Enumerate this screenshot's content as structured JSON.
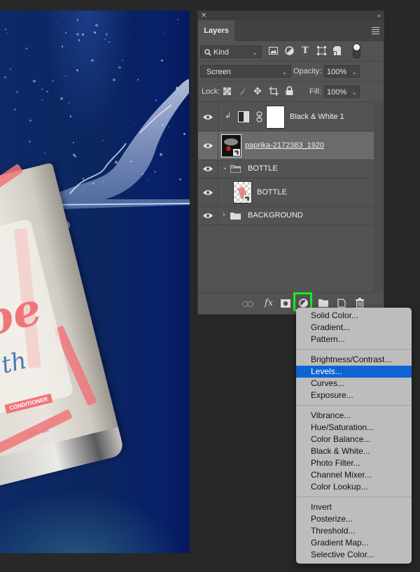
{
  "canvas": {
    "description": "Water splash with submerged bottle on blue background",
    "bottle_text": {
      "script": "oe",
      "sub": "th",
      "tag": "CONDITIONER",
      "volume": "12 FL OZ"
    }
  },
  "panel": {
    "close_icon": "✕",
    "collapse_icon": "‹‹",
    "tab_label": "Layers",
    "filter": {
      "label": "Kind",
      "icons": [
        "image-filter",
        "adjustment-filter",
        "type-filter",
        "shape-filter",
        "smart-object-filter",
        "filter-toggle"
      ]
    },
    "blend_mode": "Screen",
    "opacity_label": "Opacity:",
    "opacity_value": "100%",
    "lock_label": "Lock:",
    "fill_label": "Fill:",
    "fill_value": "100%",
    "layers": [
      {
        "name": "Black & White 1",
        "type": "adjustment",
        "visible": true,
        "clipped": true,
        "selected": false
      },
      {
        "name": "paprika-2172383_1920",
        "type": "smart-object",
        "visible": true,
        "selected": true
      },
      {
        "name": "BOTTLE",
        "type": "group",
        "expanded": true,
        "visible": true,
        "selected": false
      },
      {
        "name": "BOTTLE",
        "type": "smart-object",
        "visible": true,
        "indent": 1,
        "selected": false
      },
      {
        "name": "BACKGROUND",
        "type": "group",
        "expanded": false,
        "visible": true,
        "selected": false
      }
    ],
    "bottom_icons": [
      "link-layers",
      "fx",
      "add-mask",
      "new-adjustment-layer",
      "new-group",
      "new-layer",
      "delete-layer"
    ],
    "highlight_color": "#17ef17"
  },
  "adjustment_menu": {
    "highlighted": "Levels...",
    "highlight_color": "#0e64d2",
    "groups": [
      [
        "Solid Color...",
        "Gradient...",
        "Pattern..."
      ],
      [
        "Brightness/Contrast...",
        "Levels...",
        "Curves...",
        "Exposure..."
      ],
      [
        "Vibrance...",
        "Hue/Saturation...",
        "Color Balance...",
        "Black & White...",
        "Photo Filter...",
        "Channel Mixer...",
        "Color Lookup..."
      ],
      [
        "Invert",
        "Posterize...",
        "Threshold...",
        "Gradient Map...",
        "Selective Color..."
      ]
    ]
  }
}
